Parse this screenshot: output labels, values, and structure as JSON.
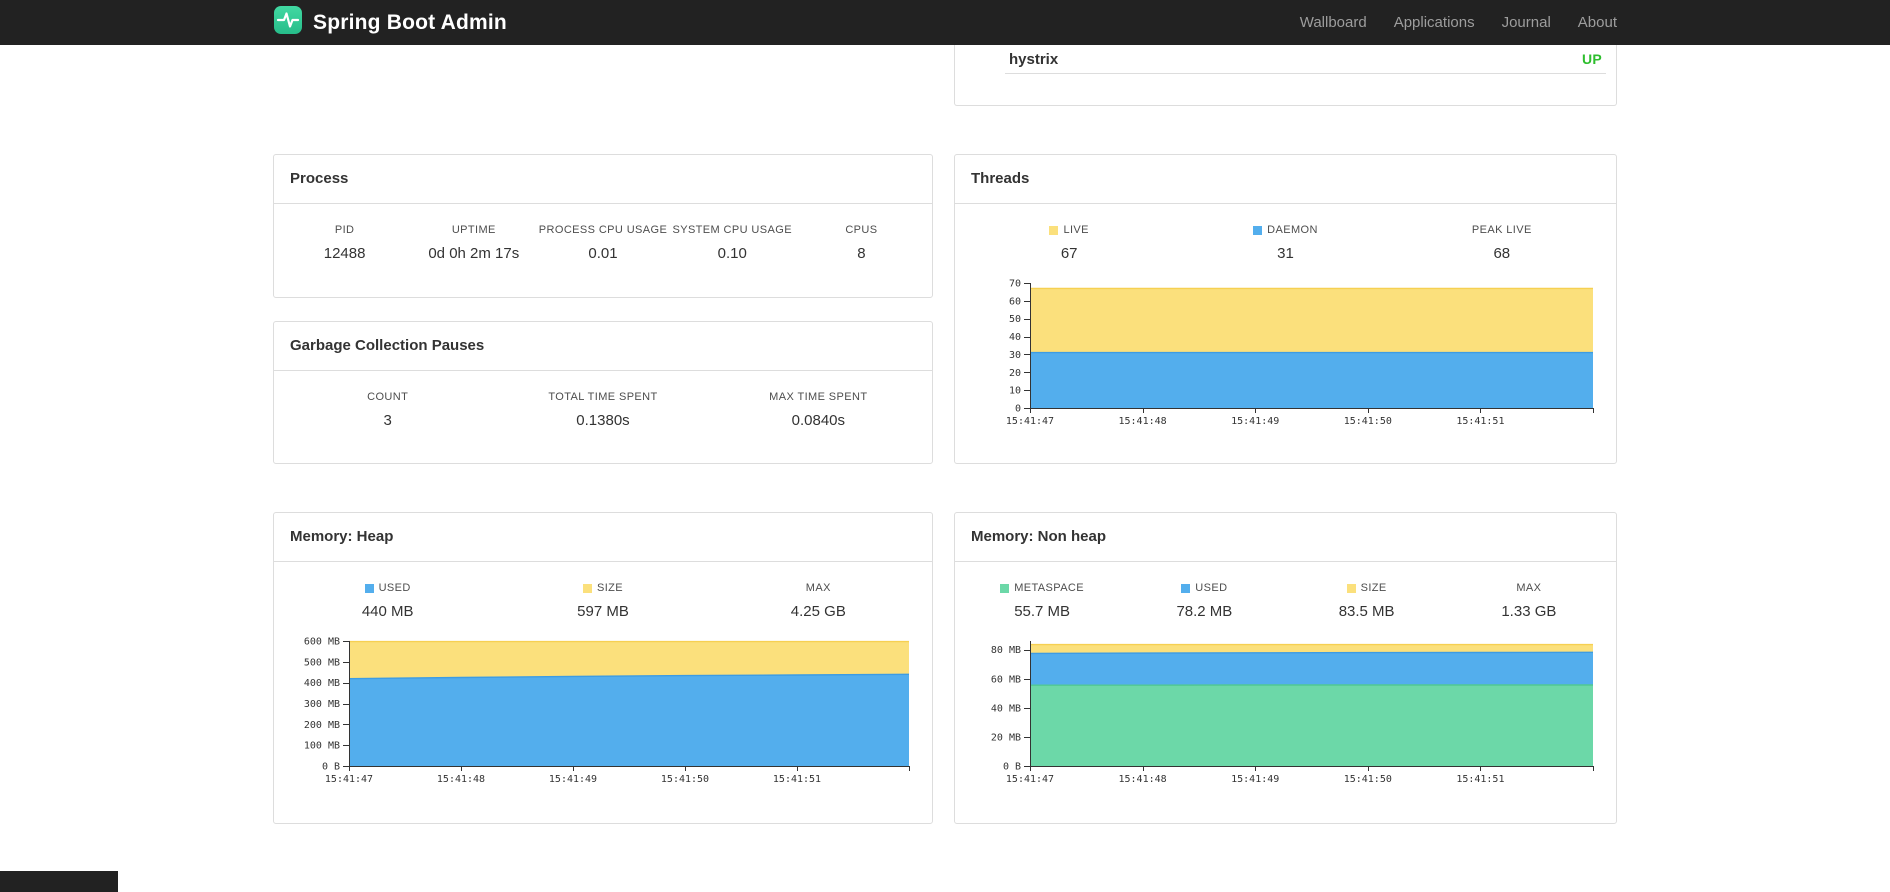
{
  "navbar": {
    "brand": "Spring Boot Admin",
    "items": [
      {
        "label": "Wallboard"
      },
      {
        "label": "Applications"
      },
      {
        "label": "Journal"
      },
      {
        "label": "About"
      }
    ]
  },
  "health_panel": {
    "row_label": "hystrix",
    "row_status": "UP",
    "status_color": "#2dbe2d"
  },
  "panels": {
    "process": {
      "title": "Process",
      "stats": [
        {
          "label": "PID",
          "value": "12488"
        },
        {
          "label": "UPTIME",
          "value": "0d 0h 2m 17s"
        },
        {
          "label": "PROCESS CPU USAGE",
          "value": "0.01"
        },
        {
          "label": "SYSTEM CPU USAGE",
          "value": "0.10"
        },
        {
          "label": "CPUS",
          "value": "8"
        }
      ]
    },
    "gc": {
      "title": "Garbage Collection Pauses",
      "stats": [
        {
          "label": "COUNT",
          "value": "3"
        },
        {
          "label": "TOTAL TIME SPENT",
          "value": "0.1380s"
        },
        {
          "label": "MAX TIME SPENT",
          "value": "0.0840s"
        }
      ]
    },
    "threads": {
      "title": "Threads",
      "stats": [
        {
          "label": "LIVE",
          "value": "67",
          "color": "#fbe07c"
        },
        {
          "label": "DAEMON",
          "value": "31",
          "color": "#53aeed"
        },
        {
          "label": "PEAK LIVE",
          "value": "68"
        }
      ],
      "chart": {
        "type": "area",
        "x_labels": [
          "15:41:47",
          "15:41:48",
          "15:41:49",
          "15:41:50",
          "15:41:51"
        ],
        "x_intervals": 5,
        "scale_max": 70,
        "y_ticks": [
          {
            "value": 0,
            "label": "0"
          },
          {
            "value": 10,
            "label": "10"
          },
          {
            "value": 20,
            "label": "20"
          },
          {
            "value": 30,
            "label": "30"
          },
          {
            "value": 40,
            "label": "40"
          },
          {
            "value": 50,
            "label": "50"
          },
          {
            "value": 60,
            "label": "60"
          },
          {
            "value": 70,
            "label": "70"
          }
        ],
        "layers": [
          {
            "name": "LIVE",
            "color": "#fbe07c",
            "line_color": "#f6d052",
            "values": [
              67,
              67,
              67,
              67,
              67,
              67
            ]
          },
          {
            "name": "DAEMON",
            "color": "#53aeed",
            "line_color": "#3d9ce3",
            "values": [
              31,
              31,
              31,
              31,
              31,
              31
            ]
          }
        ]
      }
    },
    "heap": {
      "title": "Memory: Heap",
      "stats": [
        {
          "label": "USED",
          "value": "440 MB",
          "color": "#53aeed"
        },
        {
          "label": "SIZE",
          "value": "597 MB",
          "color": "#fbe07c"
        },
        {
          "label": "MAX",
          "value": "4.25 GB"
        }
      ],
      "chart": {
        "type": "area",
        "x_labels": [
          "15:41:47",
          "15:41:48",
          "15:41:49",
          "15:41:50",
          "15:41:51"
        ],
        "x_intervals": 5,
        "scale_max": 600,
        "y_ticks": [
          {
            "value": 0,
            "label": "0 B"
          },
          {
            "value": 100,
            "label": "100 MB"
          },
          {
            "value": 200,
            "label": "200 MB"
          },
          {
            "value": 300,
            "label": "300 MB"
          },
          {
            "value": 400,
            "label": "400 MB"
          },
          {
            "value": 500,
            "label": "500 MB"
          },
          {
            "value": 600,
            "label": "600 MB"
          }
        ],
        "layers": [
          {
            "name": "SIZE",
            "color": "#fbe07c",
            "line_color": "#f6d052",
            "values": [
              597,
              597,
              597,
              597,
              597,
              597
            ]
          },
          {
            "name": "USED",
            "color": "#53aeed",
            "line_color": "#3d9ce3",
            "values": [
              419,
              425,
              430,
              434,
              437,
              440
            ]
          }
        ]
      }
    },
    "nonheap": {
      "title": "Memory: Non heap",
      "stats": [
        {
          "label": "METASPACE",
          "value": "55.7 MB",
          "color": "#6cd8a8"
        },
        {
          "label": "USED",
          "value": "78.2 MB",
          "color": "#53aeed"
        },
        {
          "label": "SIZE",
          "value": "83.5 MB",
          "color": "#fbe07c"
        },
        {
          "label": "MAX",
          "value": "1.33 GB"
        }
      ],
      "chart": {
        "type": "area",
        "x_labels": [
          "15:41:47",
          "15:41:48",
          "15:41:49",
          "15:41:50",
          "15:41:51"
        ],
        "x_intervals": 5,
        "scale_max": 86,
        "y_ticks": [
          {
            "value": 0,
            "label": "0 B"
          },
          {
            "value": 20,
            "label": "20 MB"
          },
          {
            "value": 40,
            "label": "40 MB"
          },
          {
            "value": 60,
            "label": "60 MB"
          },
          {
            "value": 80,
            "label": "80 MB"
          }
        ],
        "layers": [
          {
            "name": "SIZE",
            "color": "#fbe07c",
            "line_color": "#f6d052",
            "values": [
              83.5,
              83.5,
              83.5,
              83.5,
              83.5,
              83.5
            ]
          },
          {
            "name": "USED",
            "color": "#53aeed",
            "line_color": "#3d9ce3",
            "values": [
              77.5,
              77.7,
              77.9,
              78.0,
              78.1,
              78.2
            ]
          },
          {
            "name": "METASPACE",
            "color": "#6cd8a8",
            "line_color": "#50c893",
            "values": [
              55.6,
              55.6,
              55.7,
              55.7,
              55.7,
              55.7
            ]
          }
        ]
      }
    }
  }
}
